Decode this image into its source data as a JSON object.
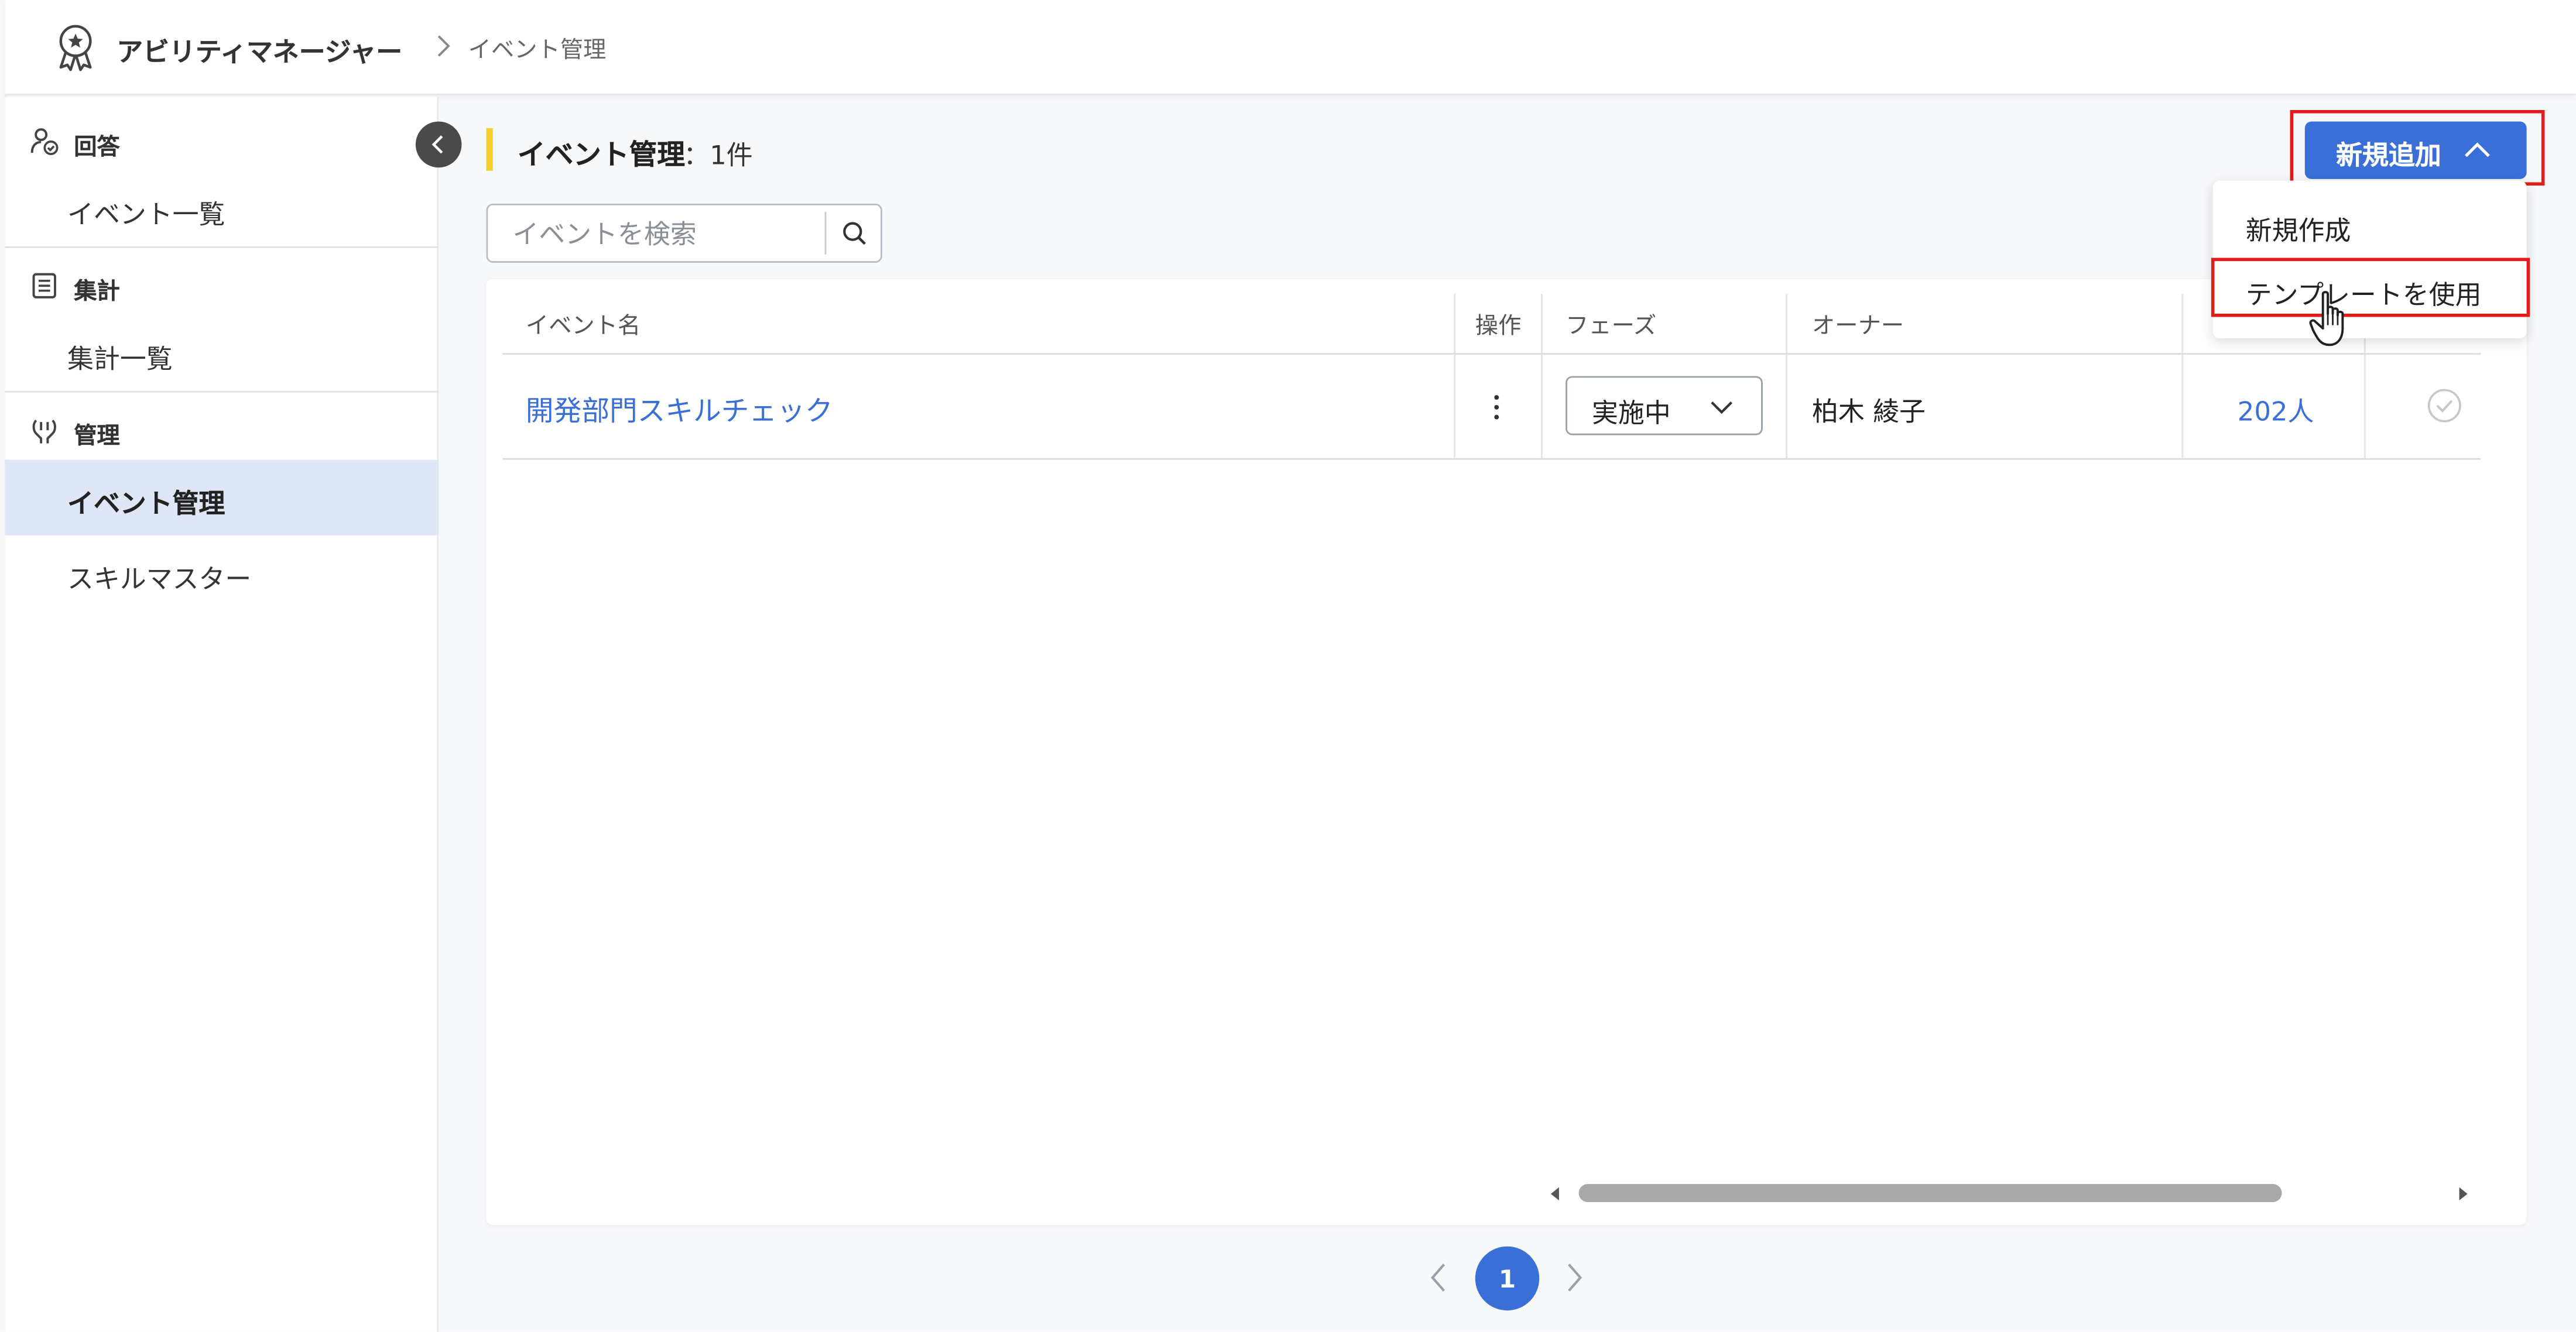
{
  "header": {
    "app_name": "アビリティマネージャー",
    "breadcrumb_current": "イベント管理"
  },
  "sidebar": {
    "sections": [
      {
        "label": "回答",
        "icon": "person-check-icon",
        "items": [
          {
            "label": "イベント一覧",
            "active": false
          }
        ]
      },
      {
        "label": "集計",
        "icon": "list-document-icon",
        "items": [
          {
            "label": "集計一覧",
            "active": false
          }
        ]
      },
      {
        "label": "管理",
        "icon": "manage-icon",
        "items": [
          {
            "label": "イベント管理",
            "active": true
          },
          {
            "label": "スキルマスター",
            "active": false
          }
        ]
      }
    ]
  },
  "main": {
    "title": "イベント管理",
    "count_text": "：1件",
    "search": {
      "placeholder": "イベントを検索",
      "value": ""
    },
    "add_button": {
      "label": "新規追加"
    },
    "add_menu": {
      "items": [
        {
          "label": "新規作成"
        },
        {
          "label": "テンプレートを使用"
        }
      ]
    },
    "table": {
      "columns": [
        "イベント名",
        "操作",
        "フェーズ",
        "オーナー"
      ],
      "rows": [
        {
          "event_name": "開発部門スキルチェック",
          "phase": "実施中",
          "owner": "柏木 綾子",
          "count": "202人",
          "status": "check-circle-icon"
        }
      ]
    },
    "pagination": {
      "current_page": "1"
    }
  },
  "colors": {
    "primary": "#3a6fd8",
    "title_accent": "#f5cf2a",
    "highlight": "#e21b1b",
    "active_nav_bg": "#dfe6f6"
  }
}
